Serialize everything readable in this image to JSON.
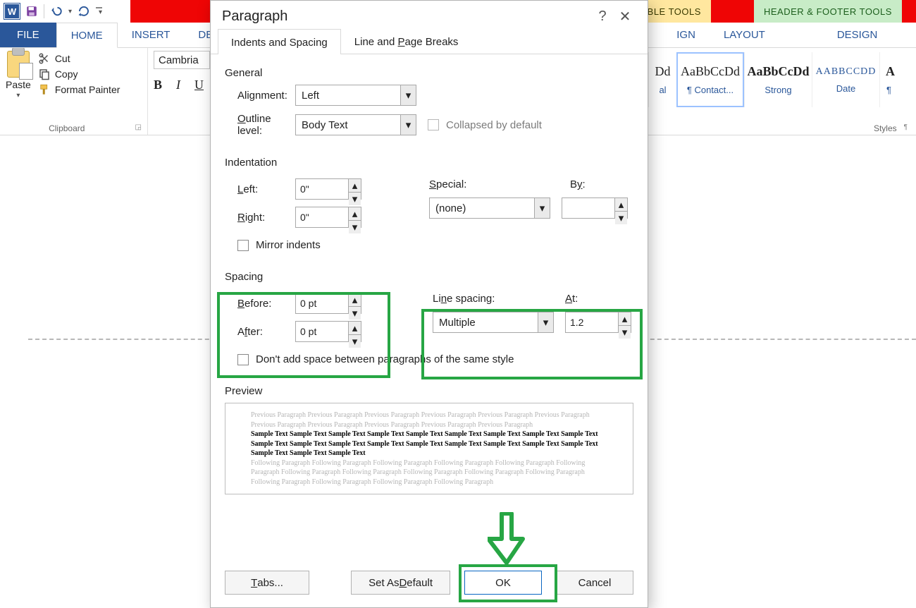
{
  "qat": {
    "app_letter": "W"
  },
  "ctx_tabs": {
    "table": "TABLE TOOLS",
    "hf": "HEADER & FOOTER TOOLS"
  },
  "ribbon_tabs": {
    "file": "FILE",
    "home": "HOME",
    "insert": "INSERT",
    "design_cut": "DE",
    "sign_cut": "IGN",
    "layout": "LAYOUT",
    "design": "DESIGN"
  },
  "clipboard": {
    "paste": "Paste",
    "cut": "Cut",
    "copy": "Copy",
    "format_painter": "Format Painter",
    "group_label": "Clipboard"
  },
  "font": {
    "name": "Cambria",
    "bold": "B",
    "italic": "I",
    "underline": "U"
  },
  "styles": {
    "s1_preview": "Dd",
    "s1_name": "al",
    "s2_preview": "AaBbCcDd",
    "s2_name": "¶ Contact...",
    "s3_preview": "AaBbCcDd",
    "s3_name": "Strong",
    "s4_preview": "AABBCCDD",
    "s4_name": "Date",
    "s5_preview": "A",
    "pil": "¶",
    "group_label": "Styles"
  },
  "dialog": {
    "title": "Paragraph",
    "help": "?",
    "close": "✕",
    "tab_indents": "Indents and Spacing",
    "tab_breaks": "Line and Page Breaks",
    "general": "General",
    "alignment_label": "Alignment:",
    "alignment_ul": "l",
    "alignment_value": "Left",
    "outline_label": "Outline level:",
    "outline_ul": "O",
    "outline_value": "Body Text",
    "collapsed": "Collapsed by default",
    "indentation": "Indentation",
    "left_label": "Left:",
    "left_ul": "L",
    "left_value": "0\"",
    "right_label": "Right:",
    "right_ul": "R",
    "right_value": "0\"",
    "special_label": "Special:",
    "special_ul": "S",
    "special_value": "(none)",
    "by_label": "By:",
    "by_ul": "y",
    "by_value": "",
    "mirror": "Mirror indents",
    "spacing": "Spacing",
    "before_label": "Before:",
    "before_ul": "B",
    "before_value": "0 pt",
    "after_label": "After:",
    "after_ul": "f",
    "after_value": "0 pt",
    "line_label": "Line spacing:",
    "line_ul": "n",
    "line_value": "Multiple",
    "at_label": "At:",
    "at_ul": "A",
    "at_value": "1.2",
    "dont_add": "Don't add space between paragraphs of the same style",
    "preview": "Preview",
    "preview_prev": "Previous Paragraph Previous Paragraph Previous Paragraph Previous Paragraph Previous Paragraph Previous Paragraph Previous Paragraph Previous Paragraph Previous Paragraph Previous Paragraph Previous Paragraph",
    "preview_sample": "Sample Text Sample Text Sample Text Sample Text Sample Text Sample Text Sample Text Sample Text Sample Text Sample Text Sample Text Sample Text Sample Text Sample Text Sample Text Sample Text Sample Text Sample Text Sample Text Sample Text Sample Text",
    "preview_next": "Following Paragraph Following Paragraph Following Paragraph Following Paragraph Following Paragraph Following Paragraph Following Paragraph Following Paragraph Following Paragraph Following Paragraph Following Paragraph Following Paragraph Following Paragraph Following Paragraph Following Paragraph",
    "tabs_btn": "Tabs...",
    "set_default": "Set As Default",
    "ok": "OK",
    "cancel": "Cancel"
  }
}
